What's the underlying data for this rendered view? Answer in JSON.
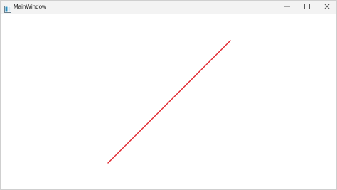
{
  "window": {
    "title": "MainWindow"
  },
  "icons": {
    "app": "app-window-icon",
    "minimize": "minimize-icon",
    "maximize": "maximize-icon",
    "close": "close-icon"
  },
  "colors": {
    "titlebar_bg": "#f3f3f3",
    "canvas_bg": "#ffffff",
    "line": "#e0242c"
  }
}
